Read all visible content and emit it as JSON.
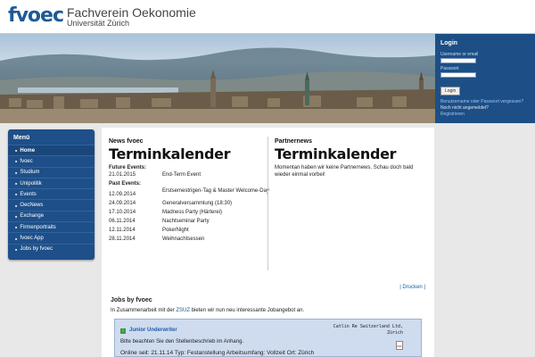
{
  "header": {
    "logo": "fvoec",
    "title": "Fachverein Oekonomie",
    "subtitle": "Universität Zürich"
  },
  "login": {
    "title": "Login",
    "username_label": "Username or email",
    "password_label": "Passwort",
    "button": "Login",
    "forgot_link": "Benutzername oder Passwort vergessen?",
    "not_registered": "Noch nicht angemeldet?",
    "register_link": "Registrieren"
  },
  "menu": {
    "title": "Menü",
    "items": [
      {
        "label": "Home"
      },
      {
        "label": "fvoec"
      },
      {
        "label": "Studium"
      },
      {
        "label": "Unipolitik"
      },
      {
        "label": "Events"
      },
      {
        "label": "OecNews"
      },
      {
        "label": "Exchange"
      },
      {
        "label": "Firmenportraits"
      },
      {
        "label": "fvoec App"
      },
      {
        "label": "Jobs by fvoec"
      }
    ]
  },
  "news": {
    "section": "News fvoec",
    "title": "Terminkalender",
    "future_label": "Future Events:",
    "future_events": [
      {
        "date": "21.01.2015",
        "name": "End-Term Event"
      }
    ],
    "past_label": "Past Events:",
    "past_events": [
      {
        "date": "12.09.2014",
        "name": "Erstsemestrigen-Tag & Master Welcome-Day"
      },
      {
        "date": "24.09.2014",
        "name": "Generalversammlung (18:30)"
      },
      {
        "date": "17.10.2014",
        "name": "Madness Party (Härterei)"
      },
      {
        "date": "06.11.2014",
        "name": "Nachtseminar Party"
      },
      {
        "date": "12.11.2014",
        "name": "PokerNight"
      },
      {
        "date": "28.11.2014",
        "name": "Weihnachtsessen"
      }
    ]
  },
  "partner": {
    "section": "Partnernews",
    "title": "Terminkalender",
    "text": "Momentan haben wir keine Partnernews. Schau doch bald wieder einmal vorbei!"
  },
  "jobs": {
    "print": "| Drucken |",
    "title": "Jobs by fvoec",
    "intro_prefix": "In Zusammenarbeit mit der",
    "intro_link": "ZSUZ",
    "intro_suffix": "bieten wir nun neu interessante Jobangebot an.",
    "listing": {
      "title": "Junior Underwriter",
      "company_line1": "Catlin Re Switzerland Ltd,",
      "company_line2": "Zürich",
      "description": "Bitte beachten Sie den Stellenbeschrieb im Anhang.",
      "meta": "Online seit: 21.11.14   Typ: Festanstellung   Arbeitsumfang: Vollzeit   Ort: Zürich",
      "attachment_icon": "pdf-icon"
    }
  }
}
